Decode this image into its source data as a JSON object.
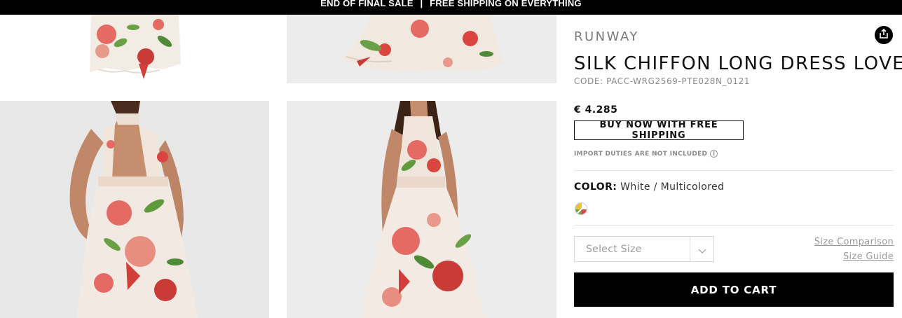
{
  "announcement": {
    "left": "END OF FINAL SALE",
    "separator": "|",
    "right": "FREE SHIPPING ON EVERYTHING"
  },
  "product": {
    "collection": "RUNWAY",
    "name": "SILK CHIFFON LONG DRESS LOVE",
    "code": "CODE: PACC-WRG2569-PTE028N_0121",
    "price": "€ 4.285",
    "buy_now_label": "BUY NOW WITH FREE SHIPPING",
    "duties_note": "IMPORT DUTIES ARE NOT INCLUDED",
    "color_label": "COLOR:",
    "color_value": "White / Multicolored",
    "size_placeholder": "Select Size",
    "size_comparison_label": "Size Comparison",
    "size_guide_label": "Size Guide",
    "add_to_cart_label": "ADD TO CART"
  },
  "colors": {
    "announcement_bg": "#000000",
    "button_bg": "#000000",
    "photo_bg": "#ececec",
    "floral_red": "#d9453f",
    "floral_green": "#5f9a3c"
  },
  "icons": {
    "share": "share-icon",
    "info": "info-icon",
    "chevron": "chevron-down-icon",
    "swatch": "color-swatch-icon"
  }
}
